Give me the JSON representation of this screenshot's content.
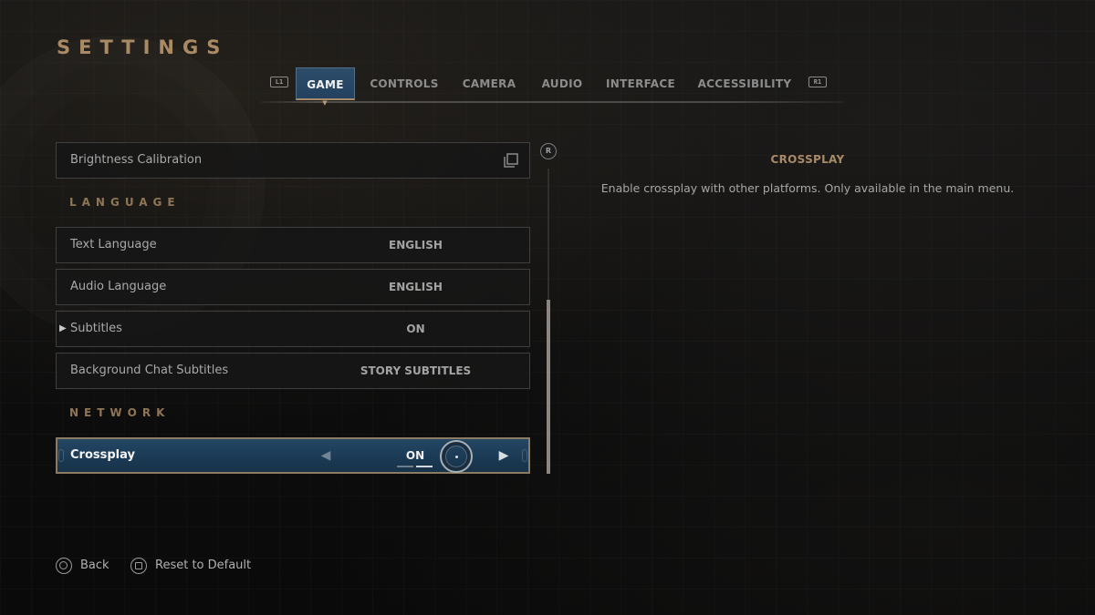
{
  "page": {
    "title": "SETTINGS"
  },
  "tabs": {
    "left_bumper": "L1",
    "right_bumper": "R1",
    "items": [
      {
        "label": "GAME",
        "active": true
      },
      {
        "label": "CONTROLS",
        "active": false
      },
      {
        "label": "CAMERA",
        "active": false
      },
      {
        "label": "AUDIO",
        "active": false
      },
      {
        "label": "INTERFACE",
        "active": false
      },
      {
        "label": "ACCESSIBILITY",
        "active": false
      }
    ]
  },
  "settings": {
    "brightness": {
      "label": "Brightness Calibration",
      "icon": "open-window-icon"
    },
    "sections": [
      {
        "heading": "LANGUAGE",
        "rows": [
          {
            "label": "Text Language",
            "value": "ENGLISH"
          },
          {
            "label": "Audio Language",
            "value": "ENGLISH"
          },
          {
            "label": "Subtitles",
            "value": "ON",
            "marker": "▶"
          },
          {
            "label": "Background Chat Subtitles",
            "value": "STORY SUBTITLES"
          }
        ]
      },
      {
        "heading": "NETWORK",
        "rows": [
          {
            "label": "Crossplay",
            "value": "ON",
            "selected": true,
            "options_count": 2,
            "option_index": 2
          }
        ]
      }
    ],
    "scroll": {
      "badge": "R",
      "position_fraction": 0.43,
      "visible_fraction": 0.57
    }
  },
  "description": {
    "title": "CROSSPLAY",
    "body": "Enable crossplay with other platforms. Only available in the main menu."
  },
  "footer": {
    "back": {
      "label": "Back",
      "icon": "circle-button-icon"
    },
    "reset": {
      "label": "Reset to Default",
      "icon": "square-button-icon"
    }
  },
  "colors": {
    "accent_gold": "#a98a64",
    "selected_blue": "#244764",
    "text_primary": "#f2f2f2",
    "text_muted": "#a9a9a9"
  }
}
